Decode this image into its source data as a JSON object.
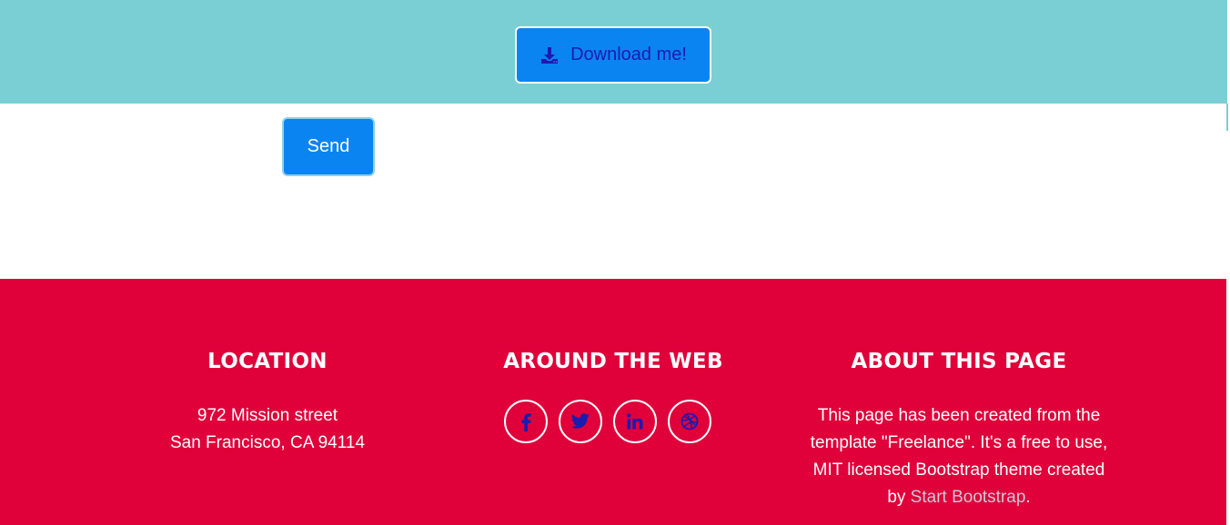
{
  "hero": {
    "download_label": "Download me!"
  },
  "contact": {
    "send_label": "Send"
  },
  "footer": {
    "location": {
      "heading": "LOCATION",
      "line1": "972 Mission street",
      "line2": "San Francisco, CA 94114"
    },
    "web": {
      "heading": "AROUND THE WEB",
      "icons": [
        "facebook-icon",
        "twitter-icon",
        "linkedin-icon",
        "dribbble-icon"
      ]
    },
    "about": {
      "heading": "ABOUT THIS PAGE",
      "text_before": "This page has been created from the template \"Freelance\". It's a free to use, MIT licensed Bootstrap theme created by ",
      "link_text": "Start Bootstrap",
      "text_after": "."
    }
  },
  "colors": {
    "top_band": "#79cfd4",
    "primary_button": "#0a84f0",
    "footer": "#e0003a",
    "icon_blue": "#1b1bb0"
  }
}
